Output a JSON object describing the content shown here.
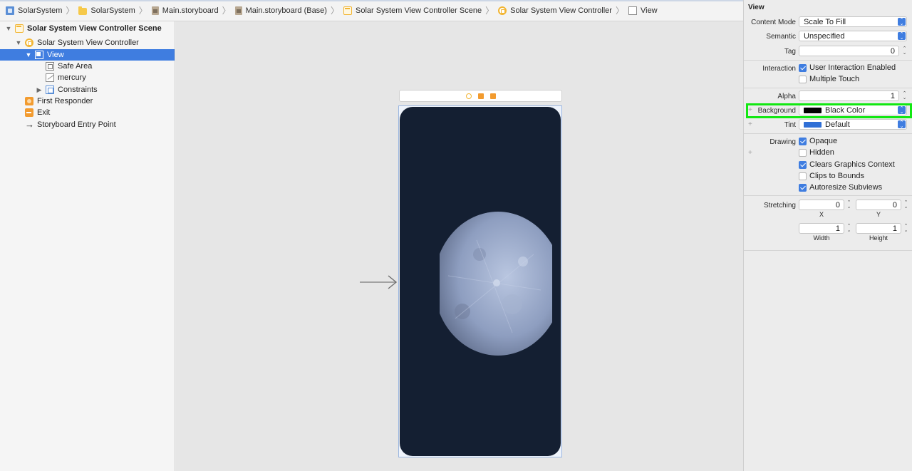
{
  "breadcrumb": [
    {
      "label": "SolarSystem",
      "icon": "project-file-icon"
    },
    {
      "label": "SolarSystem",
      "icon": "folder-icon"
    },
    {
      "label": "Main.storyboard",
      "icon": "storyboard-icon"
    },
    {
      "label": "Main.storyboard (Base)",
      "icon": "storyboard-icon"
    },
    {
      "label": "Solar System View Controller Scene",
      "icon": "scene-icon"
    },
    {
      "label": "Solar System View Controller",
      "icon": "view-controller-icon"
    },
    {
      "label": "View",
      "icon": "view-icon"
    }
  ],
  "outline": {
    "scene": "Solar System View Controller Scene",
    "view_controller": "Solar System View Controller",
    "view": "View",
    "safe_area": "Safe Area",
    "image": "mercury",
    "constraints": "Constraints",
    "first_responder": "First Responder",
    "exit": "Exit",
    "entry_point": "Storyboard Entry Point"
  },
  "inspector": {
    "title": "View",
    "content_mode_label": "Content Mode",
    "content_mode_value": "Scale To Fill",
    "semantic_label": "Semantic",
    "semantic_value": "Unspecified",
    "tag_label": "Tag",
    "tag_value": "0",
    "interaction_label": "Interaction",
    "user_interaction": "User Interaction Enabled",
    "multiple_touch": "Multiple Touch",
    "alpha_label": "Alpha",
    "alpha_value": "1",
    "background_label": "Background",
    "background_value": "Black Color",
    "background_color": "#000000",
    "tint_label": "Tint",
    "tint_value": "Default",
    "tint_color": "#2f6fd6",
    "drawing_label": "Drawing",
    "opaque": "Opaque",
    "hidden": "Hidden",
    "clears_graphics": "Clears Graphics Context",
    "clips_to_bounds": "Clips to Bounds",
    "autoresize": "Autoresize Subviews",
    "stretching_label": "Stretching",
    "stretch_x": "0",
    "stretch_y": "0",
    "stretch_width": "1",
    "stretch_height": "1",
    "x_label": "X",
    "y_label": "Y",
    "width_label": "Width",
    "height_label": "Height"
  },
  "colors": {
    "selection": "#3f7de0",
    "highlight": "#12e812",
    "canvas_background": "#141f32"
  }
}
